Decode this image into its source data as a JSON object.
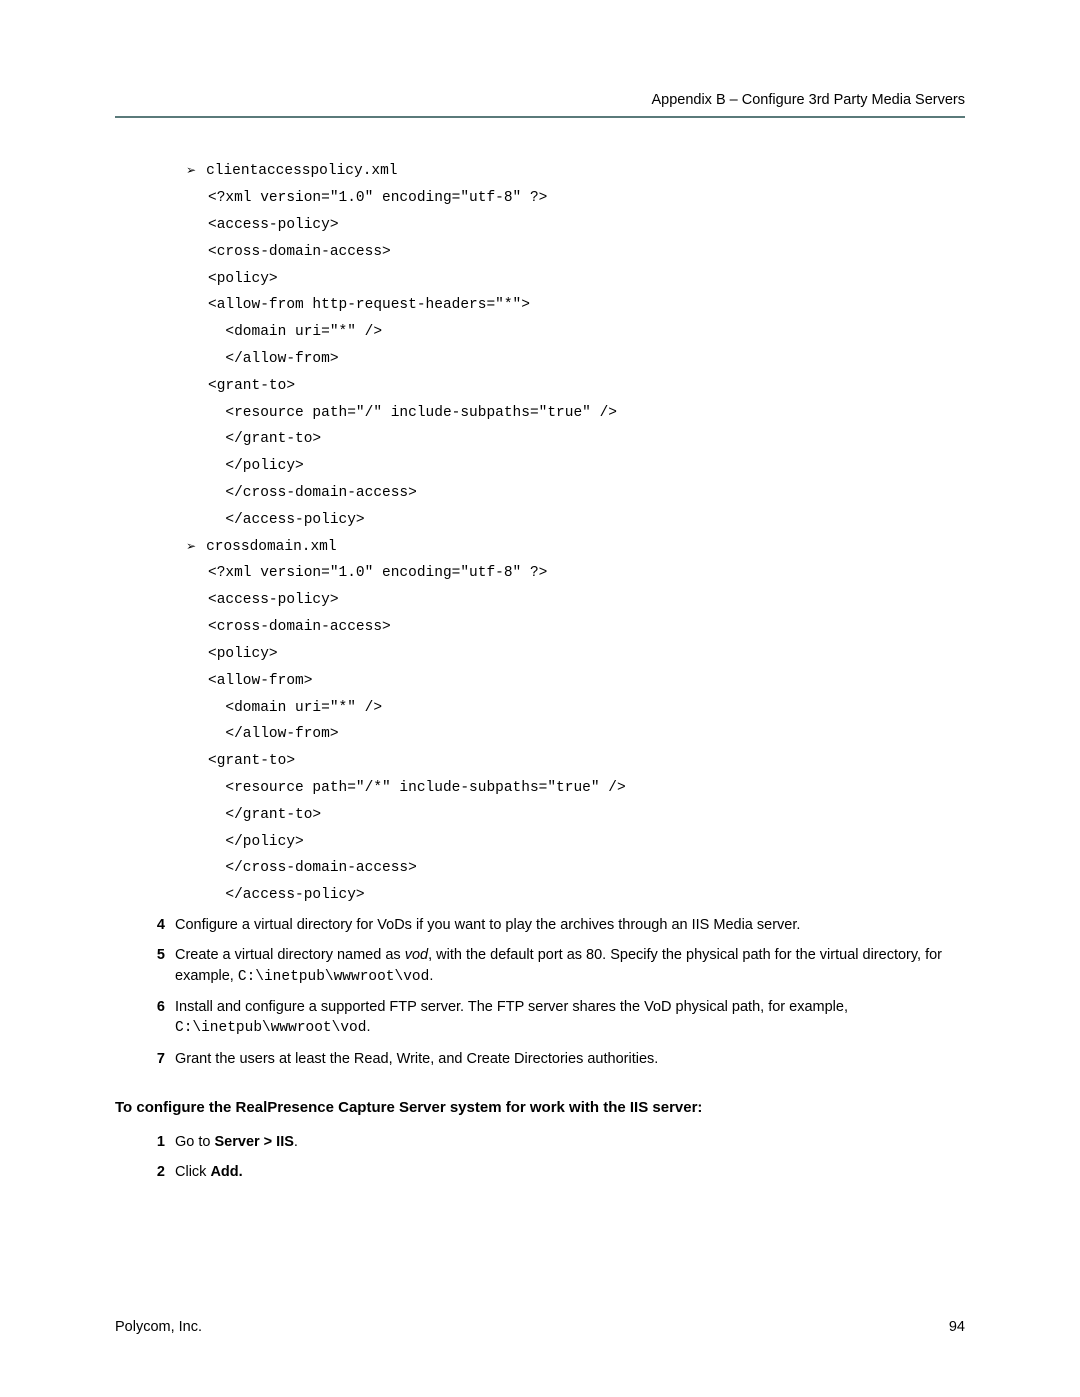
{
  "header": {
    "breadcrumb": "Appendix B – Configure 3rd Party Media Servers"
  },
  "xmlBlocks": [
    {
      "title": "clientaccesspolicy.xml",
      "lines": [
        "<?xml version=\"1.0\" encoding=\"utf-8\" ?>",
        "<access-policy>",
        "<cross-domain-access>",
        "<policy>",
        "<allow-from http-request-headers=\"*\">",
        "  <domain uri=\"*\" />",
        "  </allow-from>",
        "<grant-to>",
        "  <resource path=\"/\" include-subpaths=\"true\" />",
        "  </grant-to>",
        "  </policy>",
        "  </cross-domain-access>",
        "  </access-policy>"
      ]
    },
    {
      "title": "crossdomain.xml",
      "lines": [
        "<?xml version=\"1.0\" encoding=\"utf-8\" ?>",
        "<access-policy>",
        "<cross-domain-access>",
        "<policy>",
        "<allow-from>",
        "  <domain uri=\"*\" />",
        "  </allow-from>",
        "<grant-to>",
        "  <resource path=\"/*\" include-subpaths=\"true\" />",
        "  </grant-to>",
        "  </policy>",
        "  </cross-domain-access>",
        "  </access-policy>"
      ]
    }
  ],
  "steps1": [
    {
      "n": "4",
      "text": "Configure a virtual directory for VoDs if you want to play the archives through an IIS Media server."
    },
    {
      "n": "5",
      "pre": "Create a virtual directory named as ",
      "ital": "vod",
      "mid": ", with the default port as 80. Specify the physical path for the virtual directory, for example, ",
      "mono": "C:\\inetpub\\wwwroot\\vod",
      "post": "."
    },
    {
      "n": "6",
      "pre": "Install and configure a supported FTP server. The FTP server shares the VoD physical path, for example, ",
      "mono": "C:\\inetpub\\wwwroot\\vod",
      "post": "."
    },
    {
      "n": "7",
      "text": "Grant the users at least the Read, Write, and Create Directories authorities."
    }
  ],
  "sectionHead": "To configure the RealPresence Capture Server system for work with the IIS server:",
  "steps2": [
    {
      "n": "1",
      "pre": "Go to ",
      "bold": "Server > IIS",
      "post": "."
    },
    {
      "n": "2",
      "pre": "Click ",
      "bold": "Add.",
      "post": ""
    }
  ],
  "footer": {
    "left": "Polycom, Inc.",
    "right": "94"
  }
}
